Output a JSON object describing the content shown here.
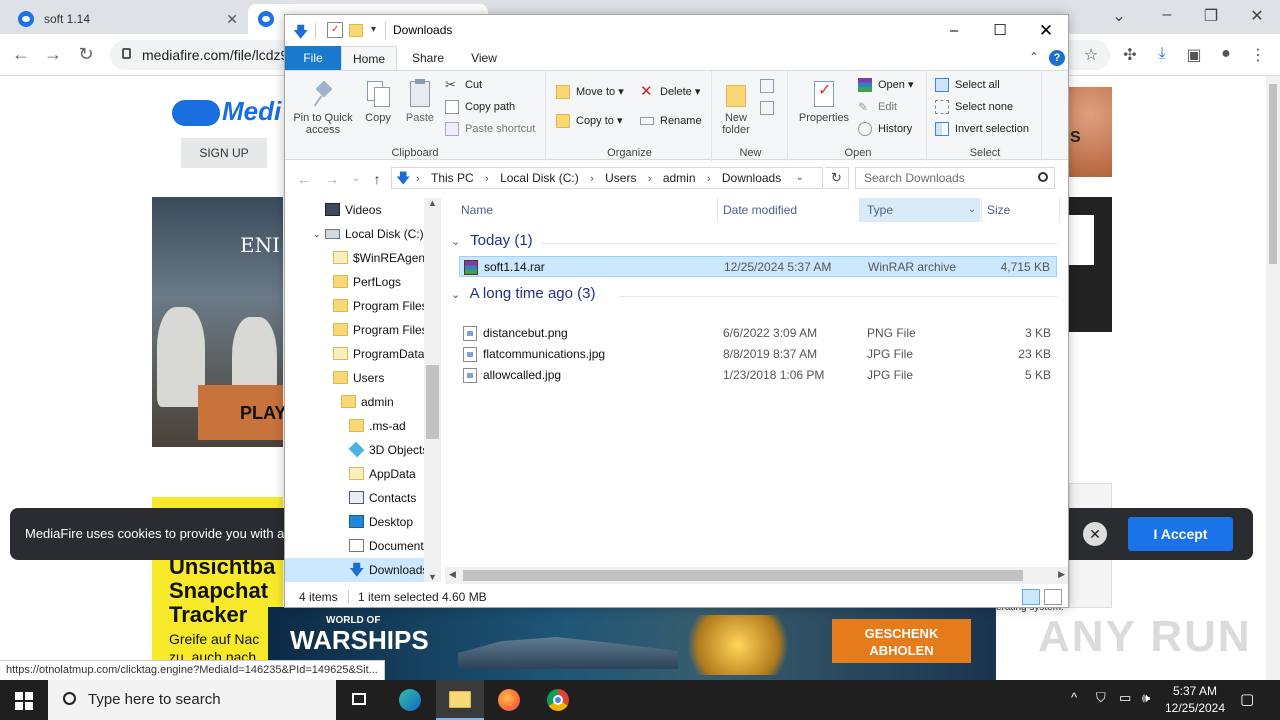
{
  "browser": {
    "tabs": [
      {
        "title": "soft 1.14"
      },
      {
        "title": ""
      }
    ],
    "url": "mediafire.com/file/lcdz9",
    "status_url": "https://otnolatmup.com/clicktag.engine?MediaId=146235&PId=149625&Sit..."
  },
  "page": {
    "logo_text": "Medi",
    "signup_label": "SIGN UP",
    "play_label": "PLAY",
    "ad_yellow_lines": [
      "Unsichtba",
      "Snapchat",
      "Tracker"
    ],
    "ad_yellow_sub": [
      "Greife auf Nac",
      "zu, auch nach"
    ],
    "right_fragment": "S",
    "right_small_text": "erating system.",
    "cookie_text": "MediaFire uses cookies to provide you with a",
    "cookie_accept": "I Accept",
    "banner": {
      "top_line": "WORLD OF",
      "brand": "WARSHIPS",
      "cta": "GESCHENK ABHOLEN"
    },
    "watermark": "ANY RUN"
  },
  "explorer": {
    "title": "Downloads",
    "ribbon_tabs": [
      "File",
      "Home",
      "Share",
      "View"
    ],
    "clipboard": {
      "pin": "Pin to Quick access",
      "copy": "Copy",
      "paste": "Paste",
      "cut": "Cut",
      "copy_path": "Copy path",
      "paste_shortcut": "Paste shortcut",
      "label": "Clipboard"
    },
    "organize": {
      "move_to": "Move to",
      "copy_to": "Copy to",
      "delete": "Delete",
      "rename": "Rename",
      "label": "Organize"
    },
    "new": {
      "new_folder": "New folder",
      "label": "New"
    },
    "open": {
      "properties": "Properties",
      "open": "Open",
      "edit": "Edit",
      "history": "History",
      "label": "Open"
    },
    "select": {
      "select_all": "Select all",
      "select_none": "Select none",
      "invert": "Invert selection",
      "label": "Select"
    },
    "breadcrumb": [
      "This PC",
      "Local Disk (C:)",
      "Users",
      "admin",
      "Downloads"
    ],
    "search_placeholder": "Search Downloads",
    "nav_items": [
      {
        "label": "Videos"
      },
      {
        "label": "Local Disk (C:)"
      },
      {
        "label": "$WinREAgent"
      },
      {
        "label": "PerfLogs"
      },
      {
        "label": "Program Files"
      },
      {
        "label": "Program Files"
      },
      {
        "label": "ProgramData"
      },
      {
        "label": "Users"
      },
      {
        "label": "admin"
      },
      {
        "label": ".ms-ad"
      },
      {
        "label": "3D Objects"
      },
      {
        "label": "AppData"
      },
      {
        "label": "Contacts"
      },
      {
        "label": "Desktop"
      },
      {
        "label": "Documents"
      },
      {
        "label": "Downloads"
      }
    ],
    "columns": [
      "Name",
      "Date modified",
      "Type",
      "Size"
    ],
    "groups": [
      {
        "title": "Today (1)",
        "files": [
          {
            "name": "soft1.14.rar",
            "date": "12/25/2024 5:37 AM",
            "type": "WinRAR archive",
            "size": "4,715 KB"
          }
        ]
      },
      {
        "title": "A long time ago (3)",
        "files": [
          {
            "name": "distancebut.png",
            "date": "6/6/2022 3:09 AM",
            "type": "PNG File",
            "size": "3 KB"
          },
          {
            "name": "flatcommunications.jpg",
            "date": "8/8/2019 8:37 AM",
            "type": "JPG File",
            "size": "23 KB"
          },
          {
            "name": "allowcalled.jpg",
            "date": "1/23/2018 1:06 PM",
            "type": "JPG File",
            "size": "5 KB"
          }
        ]
      }
    ],
    "status": {
      "items": "4 items",
      "selected": "1 item selected",
      "size": "4.60 MB"
    }
  },
  "taskbar": {
    "search_placeholder": "Type here to search",
    "time": "5:37 AM",
    "date": "12/25/2024"
  }
}
